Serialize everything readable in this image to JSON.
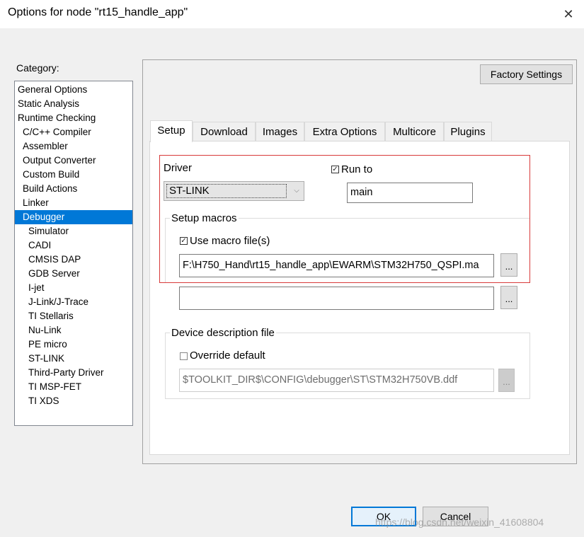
{
  "window": {
    "title": "Options for node \"rt15_handle_app\"",
    "close_glyph": "✕"
  },
  "category": {
    "label": "Category:",
    "items": [
      "General Options",
      "Static Analysis",
      "Runtime Checking",
      "C/C++ Compiler",
      "Assembler",
      "Output Converter",
      "Custom Build",
      "Build Actions",
      "Linker",
      "Debugger",
      "Simulator",
      "CADI",
      "CMSIS DAP",
      "GDB Server",
      "I-jet",
      "J-Link/J-Trace",
      "TI Stellaris",
      "Nu-Link",
      "PE micro",
      "ST-LINK",
      "Third-Party Driver",
      "TI MSP-FET",
      "TI XDS"
    ],
    "selected": "Debugger"
  },
  "factory_settings": "Factory Settings",
  "tabs": [
    "Setup",
    "Download",
    "Images",
    "Extra Options",
    "Multicore",
    "Plugins"
  ],
  "active_tab": "Setup",
  "setup": {
    "driver_label": "Driver",
    "driver_value": "ST-LINK",
    "run_to_label": "Run to",
    "run_to_checked": true,
    "run_to_value": "main",
    "setup_macros_label": "Setup macros",
    "use_macro_label": "Use macro file(s)",
    "use_macro_checked": true,
    "macro_file_1": "F:\\H750_Hand\\rt15_handle_app\\EWARM\\STM32H750_QSPI.ma",
    "macro_file_2": "",
    "browse_label": "...",
    "device_desc_label": "Device description file",
    "override_label": "Override default",
    "override_checked": false,
    "device_file": "$TOOLKIT_DIR$\\CONFIG\\debugger\\ST\\STM32H750VB.ddf"
  },
  "buttons": {
    "ok": "OK",
    "cancel": "Cancel"
  },
  "watermark": "https://blog.csdn.net/weixin_41608804",
  "colors": {
    "selection": "#0078d7",
    "highlight_box": "#d83a3a"
  }
}
